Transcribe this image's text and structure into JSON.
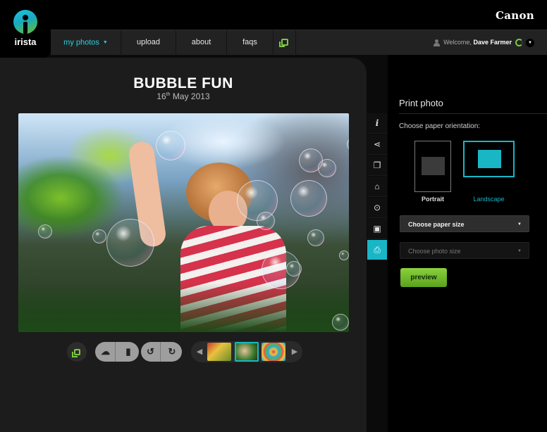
{
  "brand": "Canon",
  "logo": {
    "text": "irista"
  },
  "nav": {
    "items": [
      {
        "label": "my photos",
        "active": true
      },
      {
        "label": "upload"
      },
      {
        "label": "about"
      },
      {
        "label": "faqs"
      }
    ],
    "gallery_icon": "gallery-icon",
    "welcome_prefix": "Welcome,",
    "user_name": "Dave Farmer"
  },
  "photo": {
    "title": "BUBBLE FUN",
    "date_day": "16",
    "date_suffix": "th",
    "date_rest": " May 2013"
  },
  "side_tabs": [
    {
      "icon": "info-icon",
      "glyph": "i"
    },
    {
      "icon": "share-icon",
      "glyph": "⋖"
    },
    {
      "icon": "comment-icon",
      "glyph": "❐"
    },
    {
      "icon": "tag-icon",
      "glyph": "⌂"
    },
    {
      "icon": "location-icon",
      "glyph": "⊙"
    },
    {
      "icon": "album-icon",
      "glyph": "▣"
    },
    {
      "icon": "print-icon",
      "glyph": "⎙",
      "active": true
    }
  ],
  "print_panel": {
    "title": "Print photo",
    "orientation_label": "Choose paper orientation:",
    "portrait_label": "Portrait",
    "landscape_label": "Landscape",
    "selected_orientation": "Landscape",
    "paper_size_placeholder": "Choose paper size",
    "photo_size_placeholder": "Choose photo size",
    "preview_label": "preview"
  },
  "colors": {
    "accent": "#19b6c6",
    "green": "#6ab82e",
    "nav_bg": "#222222"
  },
  "filmstrip": {
    "thumbnails": [
      "thumbnail-1",
      "thumbnail-2",
      "thumbnail-3"
    ],
    "selected_index": 1
  }
}
